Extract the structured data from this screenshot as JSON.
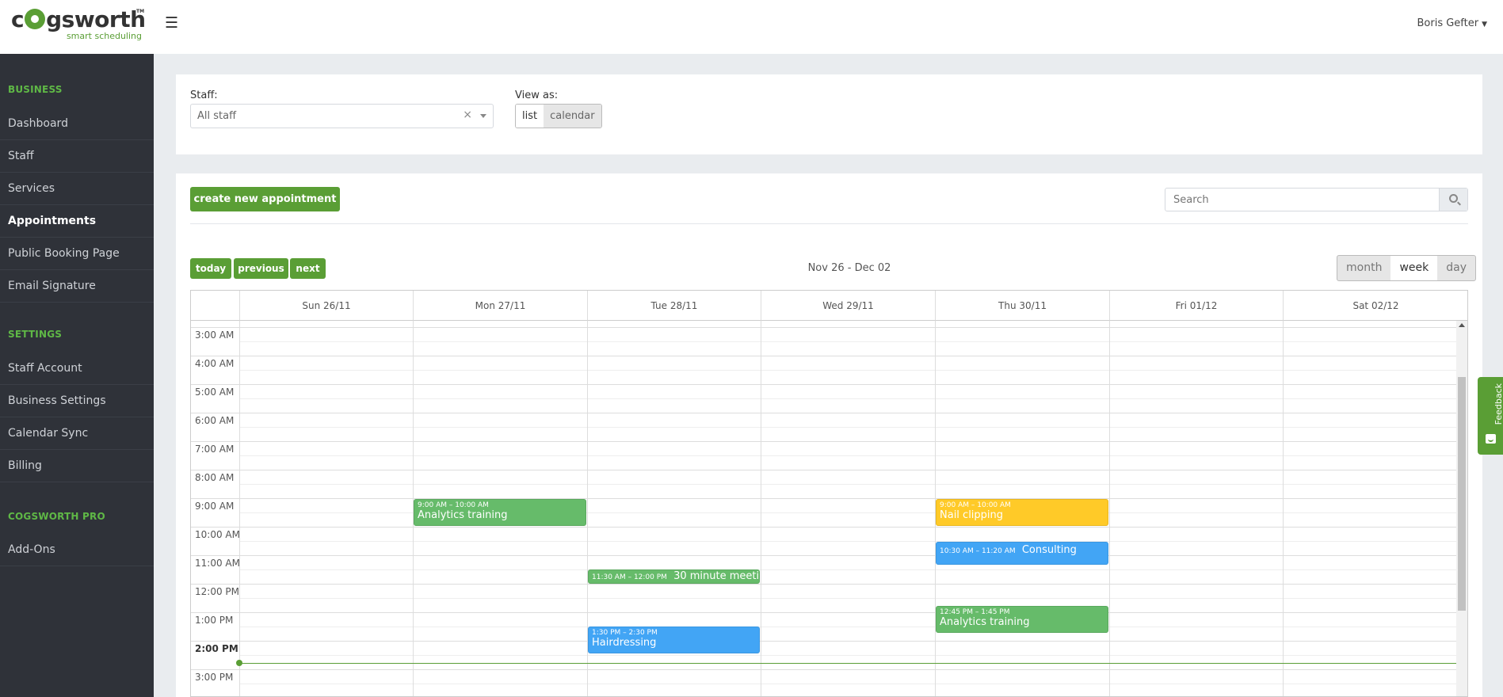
{
  "header": {
    "logo_text": "cogsworth",
    "logo_tm": "TM",
    "logo_tagline": "smart scheduling",
    "menu_icon": "☰",
    "user_name": "Boris Gefter",
    "user_caret": "▼"
  },
  "sidebar": {
    "business_title": "BUSINESS",
    "business_items": [
      "Dashboard",
      "Staff",
      "Services",
      "Appointments",
      "Public Booking Page",
      "Email Signature"
    ],
    "settings_title": "SETTINGS",
    "settings_items": [
      "Staff Account",
      "Business Settings",
      "Calendar Sync",
      "Billing"
    ],
    "pro_title": "COGSWORTH PRO",
    "pro_items": [
      "Add-Ons"
    ],
    "active_item": "Appointments"
  },
  "filters": {
    "staff_label": "Staff:",
    "staff_value": "All staff",
    "clear_symbol": "×",
    "view_label": "View as:",
    "view_options": [
      "list",
      "calendar"
    ],
    "view_selected": "list"
  },
  "toolbar": {
    "create_label": "create new appointment",
    "search_placeholder": "Search"
  },
  "calendar": {
    "nav": [
      "today",
      "previous",
      "next"
    ],
    "range_title": "Nov 26 - Dec 02",
    "views": [
      "month",
      "week",
      "day"
    ],
    "view_selected": "week",
    "days": [
      "Sun 26/11",
      "Mon 27/11",
      "Tue 28/11",
      "Wed 29/11",
      "Thu 30/11",
      "Fri 01/12",
      "Sat 02/12"
    ],
    "times": [
      "3:00 AM",
      "4:00 AM",
      "5:00 AM",
      "6:00 AM",
      "7:00 AM",
      "8:00 AM",
      "9:00 AM",
      "10:00 AM",
      "11:00 AM",
      "12:00 PM",
      "1:00 PM",
      "2:00 PM",
      "3:00 PM"
    ],
    "current_time_label": "2:00 PM",
    "events": [
      {
        "day": 1,
        "time": "9:00 AM – 10:00 AM",
        "title": "Analytics training",
        "color": "#66bb6a"
      },
      {
        "day": 4,
        "time": "9:00 AM – 10:00 AM",
        "title": "Nail clipping",
        "color": "#ffca28"
      },
      {
        "day": 4,
        "time": "10:30 AM – 11:20 AM",
        "title": "Consulting",
        "color": "#42a5f5"
      },
      {
        "day": 2,
        "time": "11:30 AM – 12:00 PM",
        "title": "30 minute meeting",
        "color": "#66bb6a"
      },
      {
        "day": 4,
        "time": "12:45 PM – 1:45 PM",
        "title": "Analytics training",
        "color": "#66bb6a"
      },
      {
        "day": 2,
        "time": "1:30 PM – 2:30 PM",
        "title": "Hairdressing",
        "color": "#42a5f5"
      }
    ]
  },
  "feedback": {
    "label": "Feedback"
  },
  "colors": {
    "brand_green": "#5a9e35",
    "sidebar_bg": "#2f3239",
    "event_green": "#66bb6a",
    "event_yellow": "#ffca28",
    "event_blue": "#42a5f5"
  }
}
